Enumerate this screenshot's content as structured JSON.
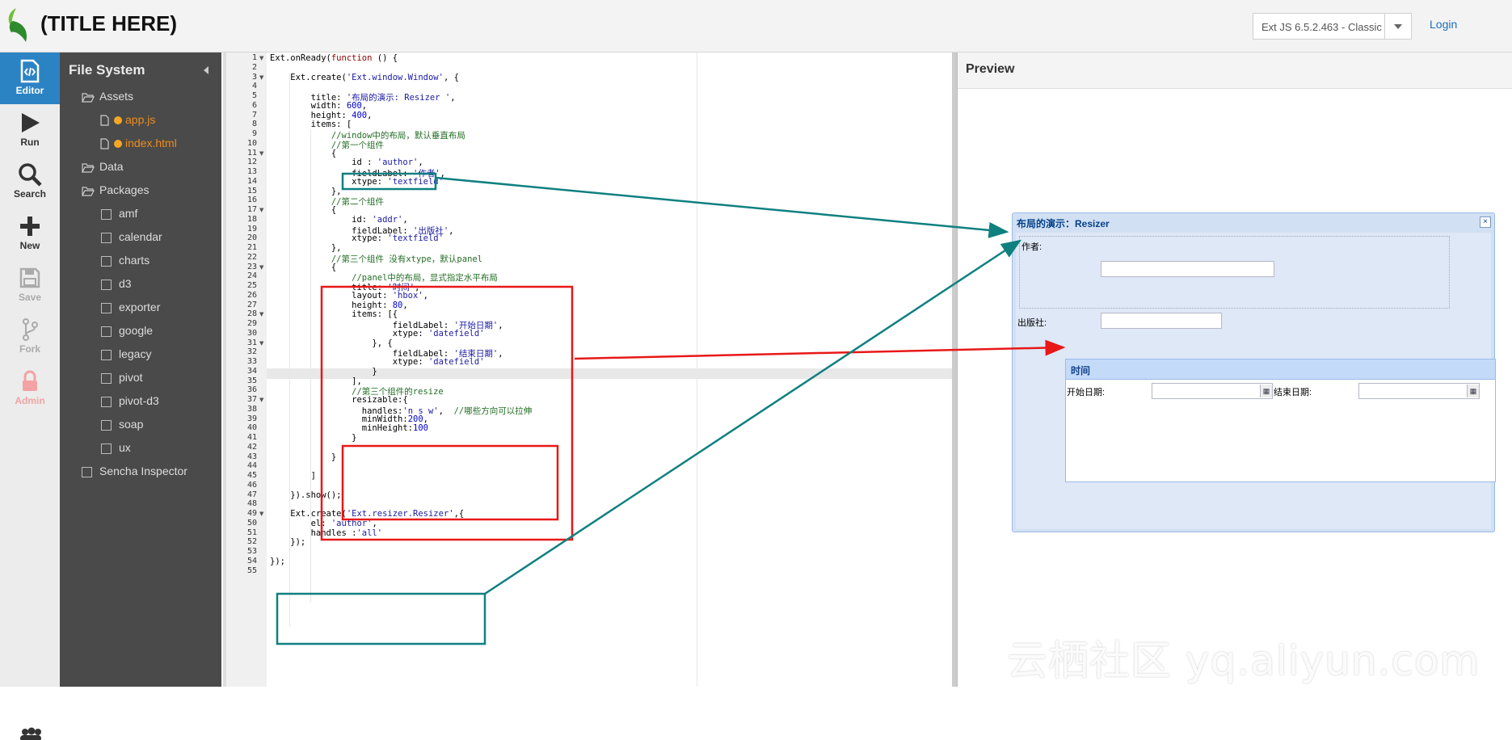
{
  "header": {
    "title": "(TITLE HERE)",
    "version": "Ext JS 6.5.2.463 - Classic",
    "login": "Login"
  },
  "nav": [
    {
      "label": "Editor",
      "icon": "code-file-icon"
    },
    {
      "label": "Run",
      "icon": "play-icon"
    },
    {
      "label": "Search",
      "icon": "search-icon"
    },
    {
      "label": "New",
      "icon": "plus-icon"
    },
    {
      "label": "Save",
      "icon": "save-icon"
    },
    {
      "label": "Fork",
      "icon": "fork-icon"
    },
    {
      "label": "Admin",
      "icon": "lock-icon"
    }
  ],
  "filesystem": {
    "title": "File System",
    "items": [
      {
        "label": "Assets",
        "type": "folder"
      },
      {
        "label": "app.js",
        "type": "file",
        "modified": true
      },
      {
        "label": "index.html",
        "type": "file",
        "modified": true
      },
      {
        "label": "Data",
        "type": "folder"
      },
      {
        "label": "Packages",
        "type": "folder"
      },
      {
        "label": "amf",
        "type": "package"
      },
      {
        "label": "calendar",
        "type": "package"
      },
      {
        "label": "charts",
        "type": "package"
      },
      {
        "label": "d3",
        "type": "package"
      },
      {
        "label": "exporter",
        "type": "package"
      },
      {
        "label": "google",
        "type": "package"
      },
      {
        "label": "legacy",
        "type": "package"
      },
      {
        "label": "pivot",
        "type": "package"
      },
      {
        "label": "pivot-d3",
        "type": "package"
      },
      {
        "label": "soap",
        "type": "package"
      },
      {
        "label": "ux",
        "type": "package"
      },
      {
        "label": "Sencha Inspector",
        "type": "checkbox"
      }
    ]
  },
  "editor": {
    "lines": [
      "Ext.onReady(function () {",
      "",
      "    Ext.create('Ext.window.Window', {",
      "",
      "        title: '布局的演示: Resizer ',",
      "        width: 600,",
      "        height: 400,",
      "        items: [",
      "            //window中的布局，默认垂直布局",
      "            //第一个组件",
      "            {",
      "                id : 'author',",
      "                fieldLabel: '作者',",
      "                xtype: 'textfield'",
      "            },",
      "            //第二个组件",
      "            {",
      "                id: 'addr',",
      "                fieldLabel: '出版社',",
      "                xtype: 'textfield'",
      "            },",
      "            //第三个组件 没有xtype，默认panel",
      "            {",
      "                //panel中的布局，显式指定水平布局",
      "                title: '时间',",
      "                layout: 'hbox',",
      "                height: 80,",
      "                items: [{",
      "                        fieldLabel: '开始日期',",
      "                        xtype: 'datefield'",
      "                    }, {",
      "                        fieldLabel: '结束日期',",
      "                        xtype: 'datefield'",
      "                    }",
      "                ],",
      "                //第三个组件的resize",
      "                resizable:{",
      "                  handles:'n s w',  //哪些方向可以拉伸",
      "                  minWidth:200,",
      "                  minHeight:100",
      "                }",
      "",
      "            }",
      "",
      "        ]",
      "",
      "    }).show();",
      "",
      "    Ext.create('Ext.resizer.Resizer',{",
      "        el: 'author',",
      "        handles :'all'",
      "    });",
      "",
      "});",
      ""
    ],
    "folded_lines": [
      1,
      3,
      11,
      17,
      23,
      28,
      31,
      37,
      49
    ]
  },
  "preview": {
    "title": "Preview",
    "window": {
      "title": "布局的演示：Resizer",
      "close": "×",
      "author_label": "作者:",
      "publisher_label": "出版社:",
      "panel_title": "时间",
      "start_label": "开始日期:",
      "end_label": "结束日期:"
    }
  },
  "watermark": "云栖社区 yq.aliyun.com",
  "colors": {
    "accent": "#2c83c4",
    "teal_annotation": "#0f8080",
    "red_annotation": "#e81818",
    "modified_file": "#f08c1a"
  }
}
